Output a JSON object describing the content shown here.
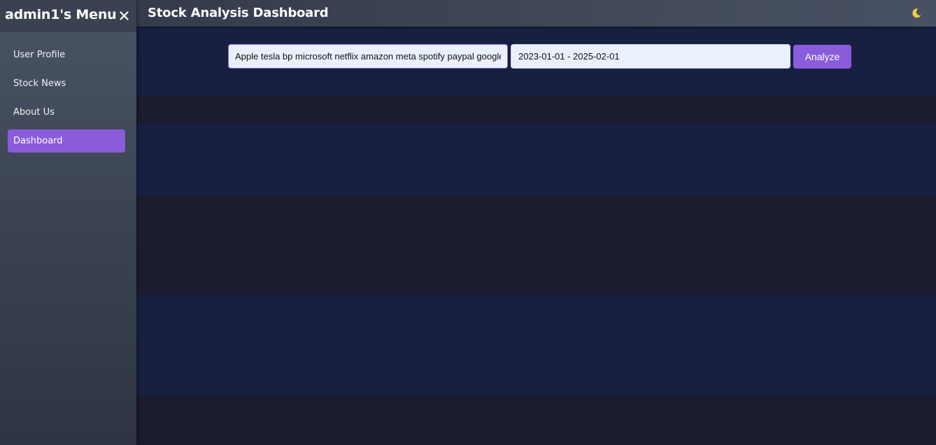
{
  "sidebar": {
    "title": "admin1's Menu",
    "close_icon": "close-icon",
    "items": [
      {
        "label": "User Profile",
        "active": false
      },
      {
        "label": "Stock News",
        "active": false
      },
      {
        "label": "About Us",
        "active": false
      },
      {
        "label": "Dashboard",
        "active": true
      }
    ]
  },
  "header": {
    "title": "Stock Analysis Dashboard",
    "theme_toggle_icon": "moon-icon"
  },
  "controls": {
    "tickers_value": "Apple tesla bp microsoft netflix amazon meta spotify paypal google",
    "date_range_value": "2023-01-01 - 2025-02-01",
    "analyze_label": "Analyze"
  },
  "colors": {
    "accent": "#8a5cdb",
    "moon": "#f2c94c",
    "band_dark": "#1b1c2f",
    "band_light": "#172040"
  }
}
